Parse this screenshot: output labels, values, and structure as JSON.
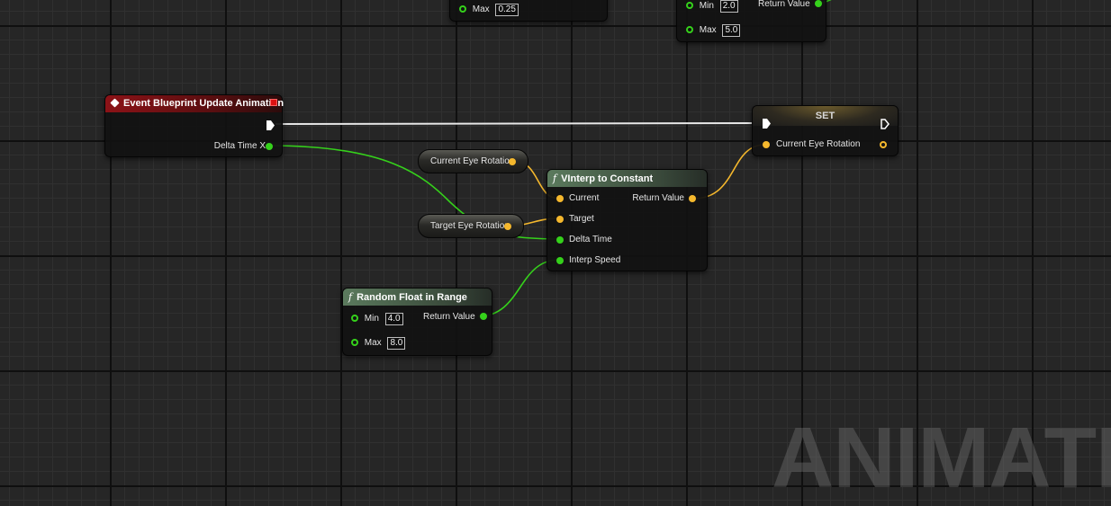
{
  "watermark": "ANIMATIO",
  "colors": {
    "float_pin": "#35d11b",
    "vector_pin": "#f5b82d",
    "exec_wire": "#ffffff",
    "event_header": "#8c1217",
    "function_header": "#5b7a5d"
  },
  "top_partial_node_a": {
    "max_label": "Max",
    "max_value": "0.25"
  },
  "top_partial_node_b": {
    "min_label": "Min",
    "min_value": "2.0",
    "max_label": "Max",
    "max_value": "5.0",
    "return_label": "Return Value"
  },
  "event_node": {
    "title": "Event Blueprint Update Animation",
    "icon": "event-diamond-icon",
    "delta_label": "Delta Time X"
  },
  "set_node": {
    "title": "SET",
    "var_label": "Current Eye Rotation"
  },
  "get_current": {
    "label": "Current Eye Rotation"
  },
  "get_target": {
    "label": "Target Eye Rotation"
  },
  "vinterp_node": {
    "fn_symbol": "f",
    "title": "VInterp to Constant",
    "current_label": "Current",
    "target_label": "Target",
    "delta_label": "Delta Time",
    "speed_label": "Interp Speed",
    "return_label": "Return Value"
  },
  "random_node": {
    "fn_symbol": "f",
    "title": "Random Float in Range",
    "min_label": "Min",
    "min_value": "4.0",
    "max_label": "Max",
    "max_value": "8.0",
    "return_label": "Return Value"
  }
}
